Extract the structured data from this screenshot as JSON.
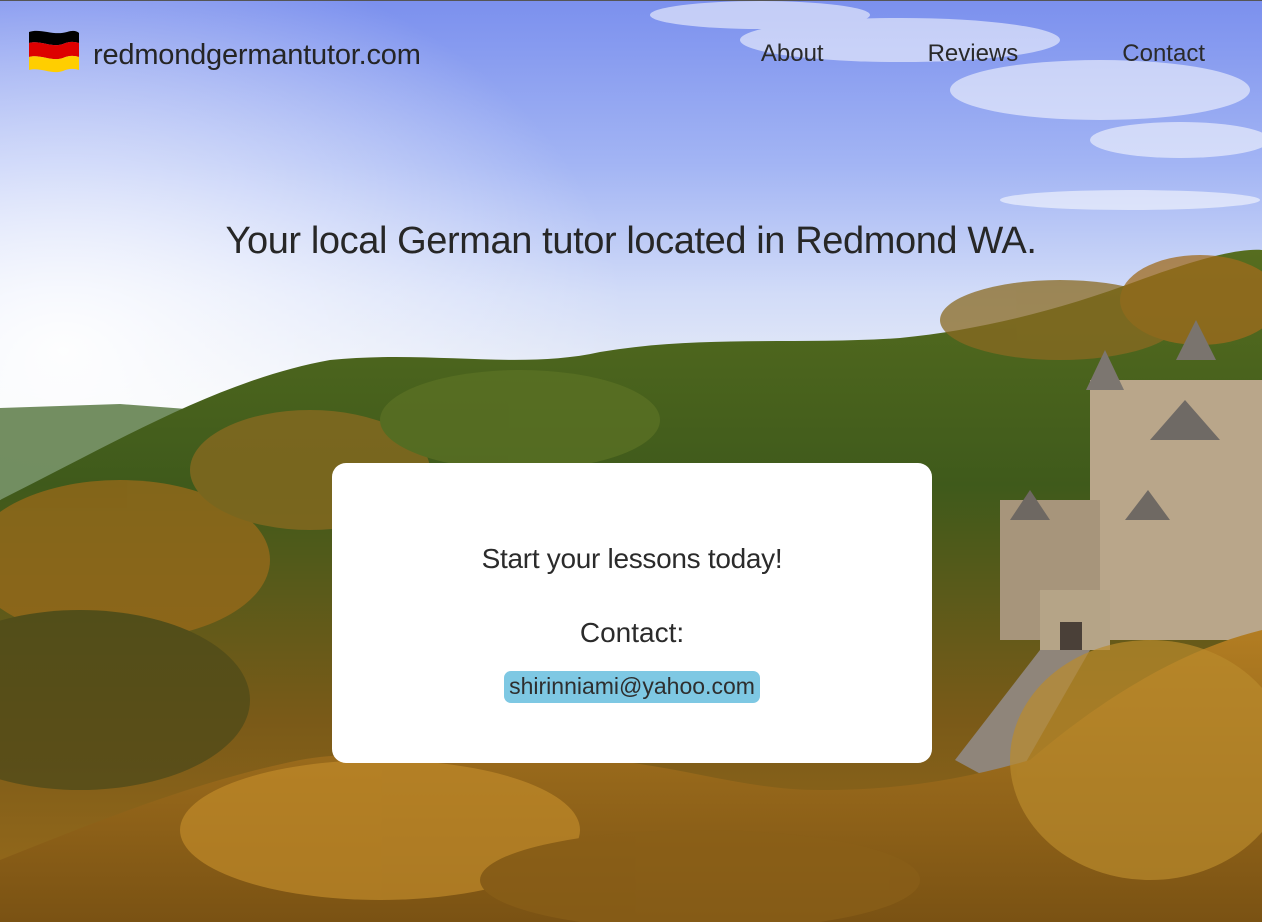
{
  "header": {
    "brand_icon": "germany-flag-icon",
    "brand_name": "redmondgermantutor.com",
    "nav": [
      {
        "label": "About"
      },
      {
        "label": "Reviews"
      },
      {
        "label": "Contact"
      }
    ]
  },
  "hero": {
    "headline": "Your local German tutor located in Redmond WA."
  },
  "card": {
    "title": "Start your lessons today!",
    "contact_label": "Contact:",
    "email": "shirinniami@yahoo.com"
  },
  "colors": {
    "email_highlight": "#7ec8e3",
    "card_background": "#ffffff",
    "flag_black": "#000000",
    "flag_red": "#dd0000",
    "flag_gold": "#ffce00"
  }
}
